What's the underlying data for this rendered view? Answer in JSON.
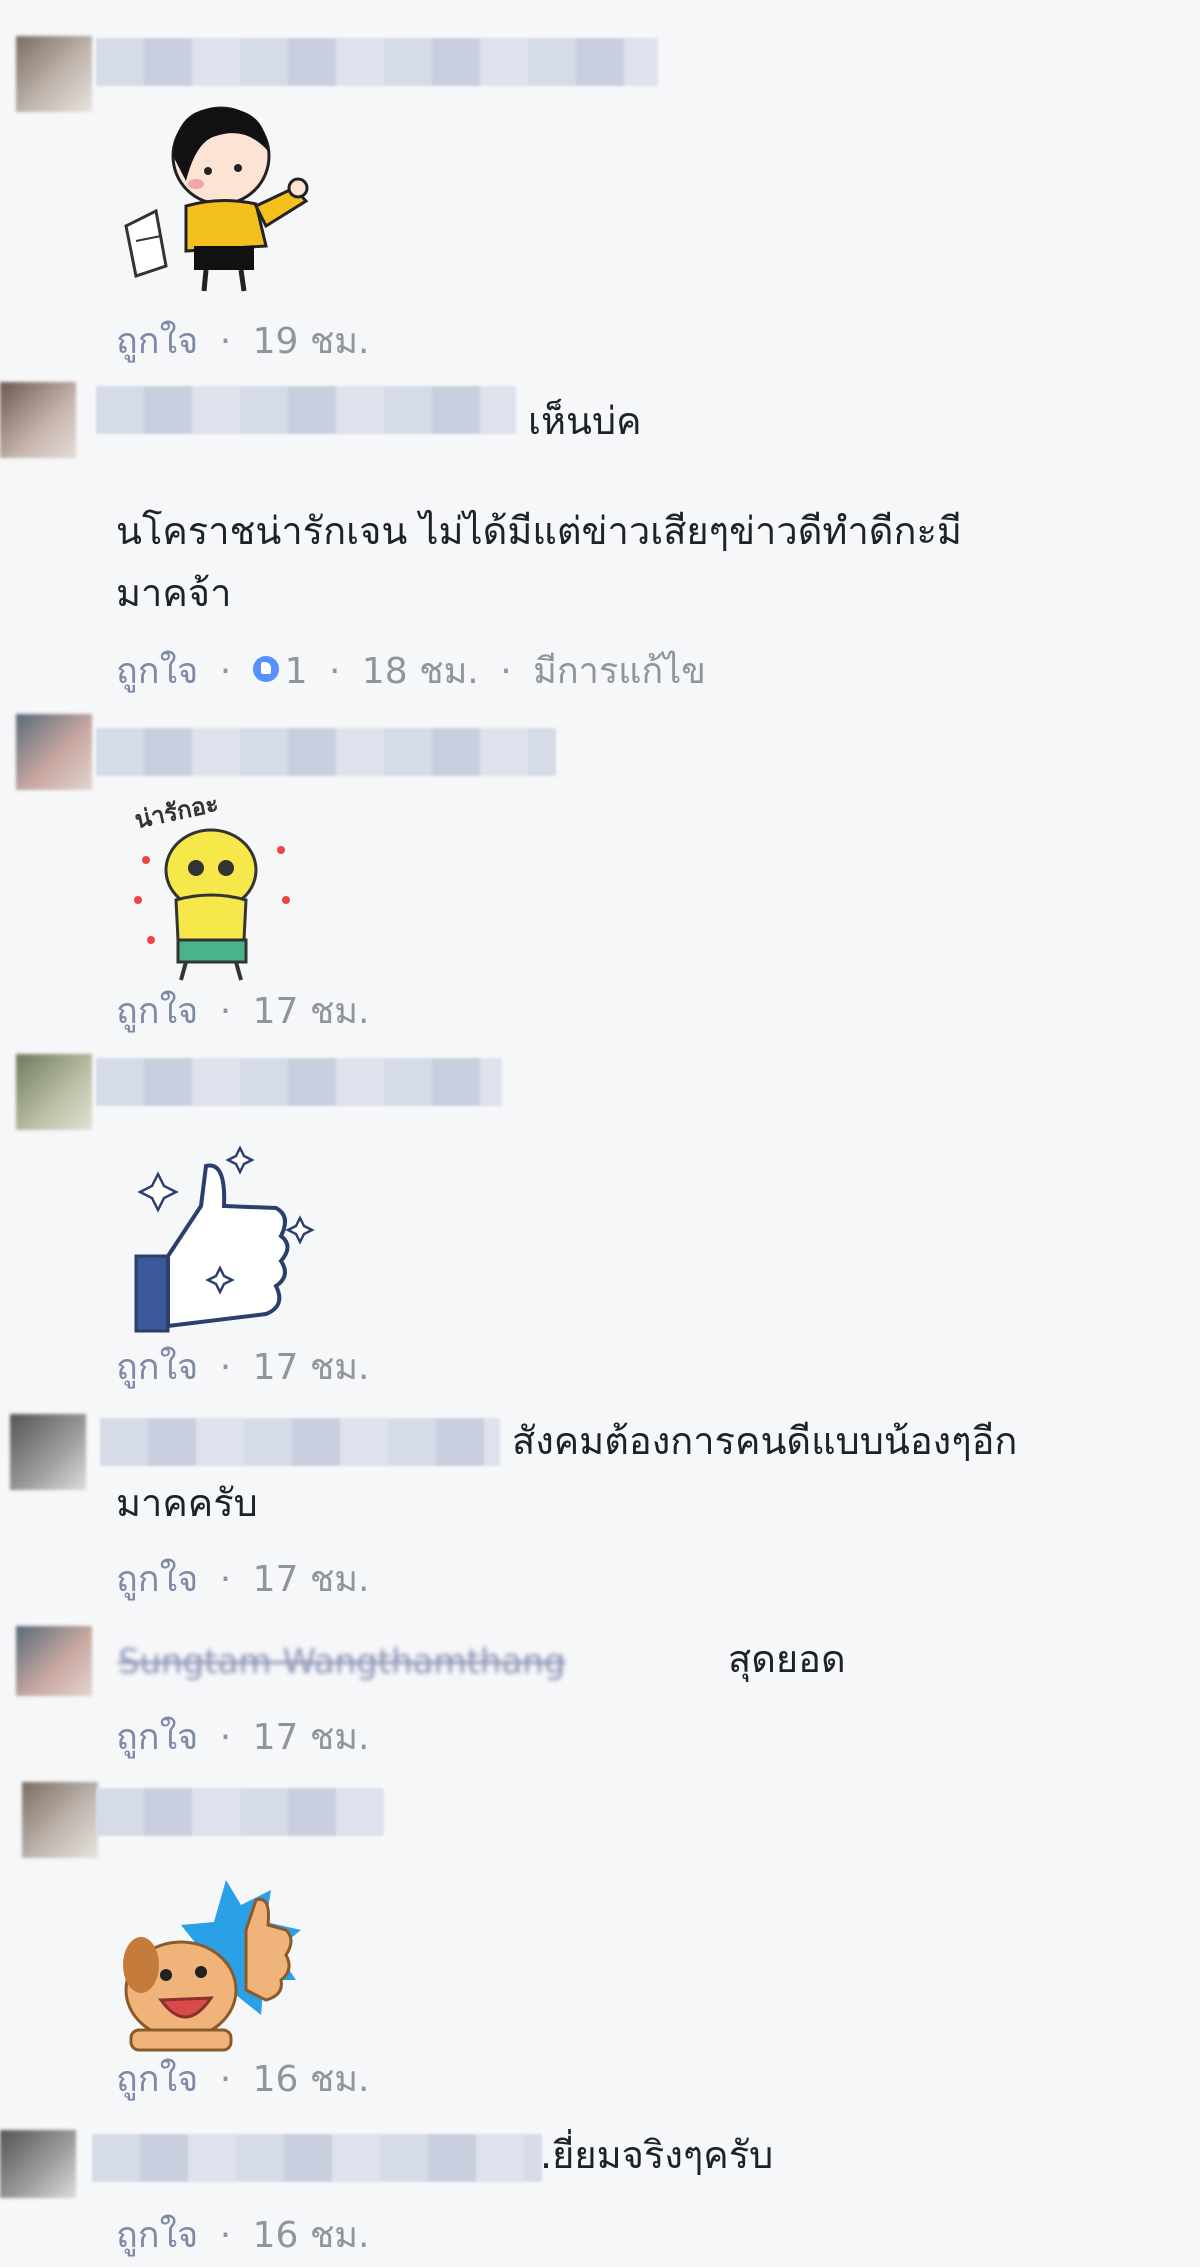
{
  "labels": {
    "like": "ถูกใจ",
    "dot": "·",
    "edited": "มีการแก้ไข"
  },
  "comments": [
    {
      "time": "19 ชม.",
      "sticker": "girl-thumbs-up-sticker"
    },
    {
      "text_inline": "เห็นบ่ค",
      "text_body_1": "นโคราชน่ารักเจน ไม่ได้มีแต่ข่าวเสียๆข่าวดีทำดีกะมี",
      "text_body_2": "มาคจ้า",
      "reaction_count": "1",
      "time": "18 ชม."
    },
    {
      "time": "17 ชม.",
      "sticker": "cute-thank-you-sticker",
      "sticker_text": "น่ารักอะ"
    },
    {
      "time": "17 ชม.",
      "sticker": "sparkling-like-sticker"
    },
    {
      "text_inline": "สังคมต้องการคนดีแบบน้องๆอีก",
      "text_body_1": "มาคครับ",
      "time": "17 ชม."
    },
    {
      "name_blurred": "Sungtam Wangthamthang",
      "text_inline": "สุดยอด",
      "time": "17 ชม."
    },
    {
      "time": "16 ชม.",
      "sticker": "dog-thumbs-up-sticker"
    },
    {
      "text_inline": ".ยี่ยมจริงๆครับ",
      "time": "16 ชม."
    }
  ],
  "colors": {
    "background": "#f6f7f9",
    "text": "#1d2129",
    "meta": "#90949c",
    "like": "#7f8ba6",
    "reaction": "#5890ff"
  }
}
